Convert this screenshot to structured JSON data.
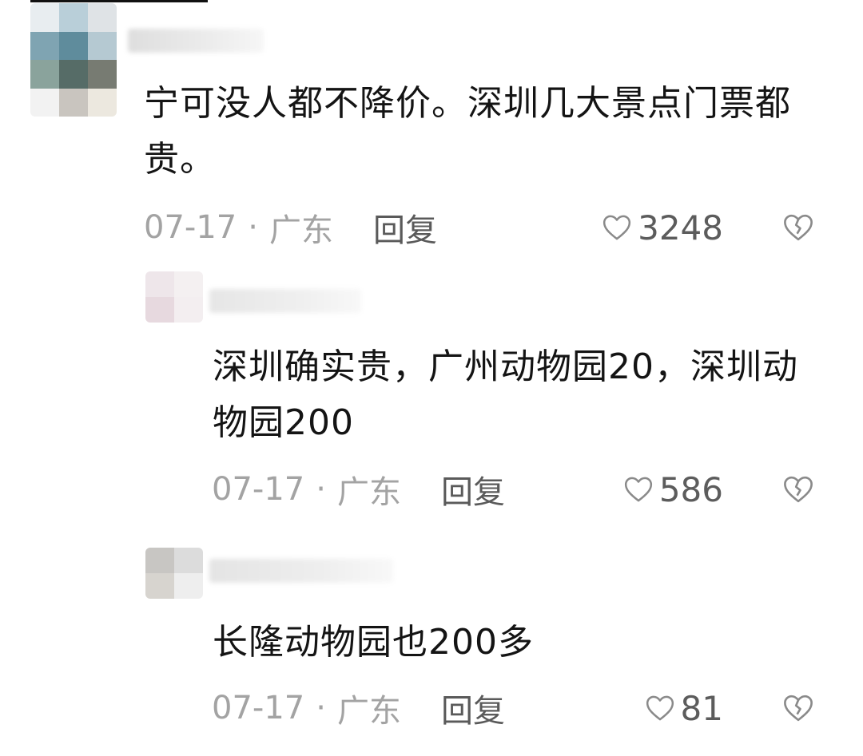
{
  "comment": {
    "text": "宁可没人都不降价。深圳几大景点门票都贵。",
    "date": "07-17",
    "separator": "·",
    "location": "广东",
    "reply_label": "回复",
    "likes": "3248"
  },
  "replies": [
    {
      "text": "深圳确实贵，广州动物园20，深圳动物园200",
      "date": "07-17",
      "separator": "·",
      "location": "广东",
      "reply_label": "回复",
      "likes": "586"
    },
    {
      "text": "长隆动物园也200多",
      "date": "07-17",
      "separator": "·",
      "location": "广东",
      "reply_label": "回复",
      "likes": "81"
    }
  ],
  "icons": {
    "like": "heart-outline-icon",
    "dislike": "broken-heart-icon"
  },
  "colors": {
    "text": "#141414",
    "meta": "#a3a3a3",
    "reply": "#5a5a5a",
    "icon": "#8a8a8a"
  }
}
